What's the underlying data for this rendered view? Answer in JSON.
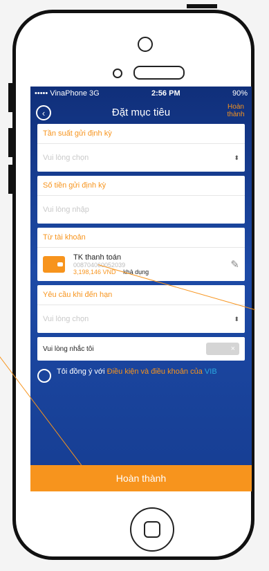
{
  "status": {
    "carrier": "••••• VinaPhone 3G",
    "time": "2:56 PM",
    "battery": "90%"
  },
  "nav": {
    "title": "Đặt mục tiêu",
    "done": "Hoàn thành"
  },
  "form": {
    "frequency_label": "Tần suất gửi định kỳ",
    "frequency_placeholder": "Vui lòng chọn",
    "amount_label": "Số tiền gửi định kỳ",
    "amount_placeholder": "Vui lòng nhập",
    "account_label": "Từ tài khoản",
    "account_name": "TK thanh toán",
    "account_number": "008704060052039",
    "balance": "3,198,146 VND",
    "balance_suffix": "khả dụng",
    "due_label": "Yêu cầu khi đến hạn",
    "due_placeholder": "Vui lòng chọn",
    "reminder_label": "Vui lòng nhắc tôi",
    "toggle_off": "×"
  },
  "terms": {
    "text": "Tôi đồng ý với",
    "link1": "Điều kiện và điều khoản của",
    "link2": "VIB"
  },
  "submit_label": "Hoàn thành",
  "colors": {
    "accent": "#f7941d",
    "background": "#1d4aa6"
  }
}
